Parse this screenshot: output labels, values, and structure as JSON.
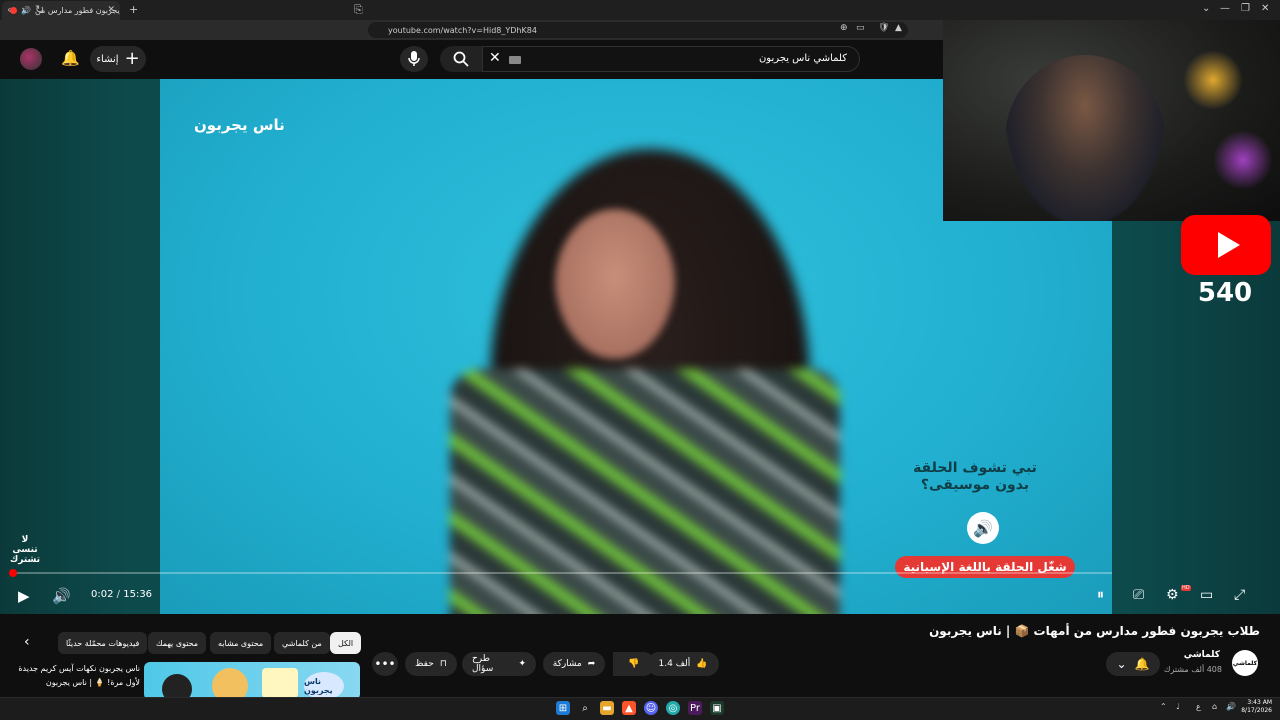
{
  "browser": {
    "tab_title": "طلاب يجربون فطور مدارس من",
    "new_tab": "+",
    "url": "youtube.com/watch?v=Hid8_YDhK84",
    "window_controls": [
      "⌄",
      "—",
      "❐",
      "✕"
    ]
  },
  "header": {
    "create_label": "إنشاء",
    "search_query": "كلماشي ناس يجربون",
    "icons": [
      "avatar",
      "bell-icon",
      "plus-icon",
      "mic-icon",
      "search-icon",
      "clear-icon"
    ]
  },
  "video": {
    "brand_overlay": "ناس يجربون",
    "promo_question": "تبي تشوف الحلقة بدون موسيقى؟",
    "spanish_cta": "شغّل الحلقة باللغة الإسبانية",
    "corner_text": "لا تنسى تشترك",
    "progress_fraction": 0.002
  },
  "controls": {
    "current_time": "0:02",
    "separator": "/",
    "duration": "15:36",
    "hd_badge": "HD"
  },
  "overlay": {
    "yt_counter": "540"
  },
  "meta": {
    "title": "طلاب يجربون فطور مدارس من أمهات 📦 | ناس يجربون",
    "channel_name": "كلماشي",
    "channel_avatar_text": "كلماشي",
    "subscribers": "408 ألف مشترك",
    "likes": "1.4 ألف",
    "share_label": "مشاركة",
    "ask_label": "طرح سؤال",
    "save_label": "حفظ"
  },
  "chips": [
    "الكل",
    "من كلماشي",
    "محتوى مشابه",
    "محتوى يهمك",
    "فيديوهات محمّلة حديثًا"
  ],
  "recommendation": {
    "title": "ناس يجربون نكهات آيس كريم جديدة لأول مرة! 🍦 | ناس يجربون",
    "thumb_text": "ناس يجربون"
  },
  "taskbar": {
    "clock_time": "3:43 AM",
    "clock_date": "8/17/2026",
    "lang": "ع"
  }
}
